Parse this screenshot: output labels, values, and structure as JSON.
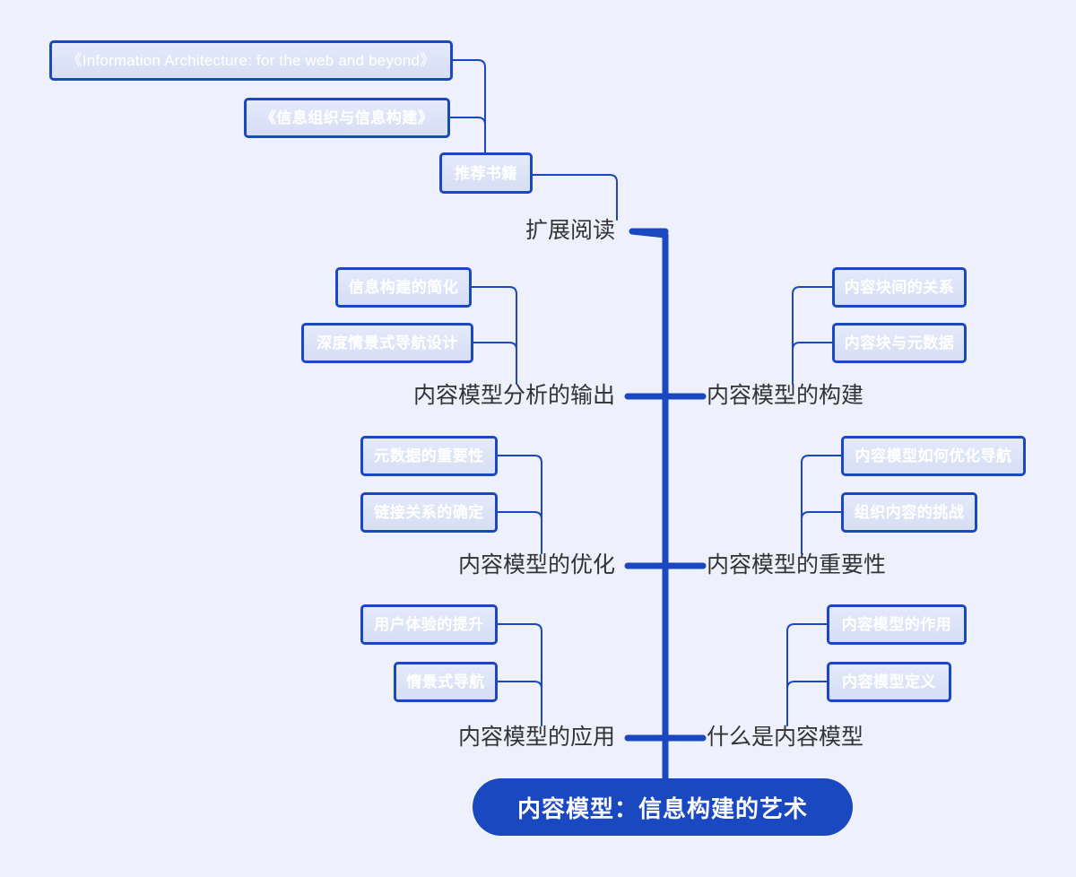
{
  "canvas": {
    "background_color": "#eef0fe",
    "trunk_color": "#1a48c0",
    "leaf_border_color": "#1a48c0",
    "leaf_fill_color": "#dce3f7",
    "leaf_text_color": "#ffffff",
    "branch_label_color": "#333333"
  },
  "root": {
    "label": "内容模型：信息构建的艺术"
  },
  "branches": [
    {
      "id": "extended-reading",
      "label": "扩展阅读",
      "side": "left",
      "children": [
        {
          "id": "recommended-books",
          "label": "推荐书籍",
          "children": [
            {
              "id": "book-ia-web-beyond",
              "label": "《Information Architecture: for the web and beyond》"
            },
            {
              "id": "book-info-org-ia",
              "label": "《信息组织与信息构建》"
            }
          ]
        }
      ]
    },
    {
      "id": "content-model-analysis-output",
      "label": "内容模型分析的输出",
      "side": "left",
      "leaves": [
        {
          "id": "simplify-ia",
          "label": "信息构建的简化"
        },
        {
          "id": "deep-contextual-nav-design",
          "label": "深度情景式导航设计"
        }
      ]
    },
    {
      "id": "content-model-construction",
      "label": "内容模型的构建",
      "side": "right",
      "leaves": [
        {
          "id": "relations-between-content-blocks",
          "label": "内容块间的关系"
        },
        {
          "id": "content-blocks-and-metadata",
          "label": "内容块与元数据"
        }
      ]
    },
    {
      "id": "content-model-optimization",
      "label": "内容模型的优化",
      "side": "left",
      "leaves": [
        {
          "id": "importance-of-metadata",
          "label": "元数据的重要性"
        },
        {
          "id": "determining-link-relations",
          "label": "链接关系的确定"
        }
      ]
    },
    {
      "id": "content-model-importance",
      "label": "内容模型的重要性",
      "side": "right",
      "leaves": [
        {
          "id": "how-content-model-optimizes-nav",
          "label": "内容模型如何优化导航"
        },
        {
          "id": "challenge-of-organizing-content",
          "label": "组织内容的挑战"
        }
      ]
    },
    {
      "id": "content-model-application",
      "label": "内容模型的应用",
      "side": "left",
      "leaves": [
        {
          "id": "improving-user-experience",
          "label": "用户体验的提升"
        },
        {
          "id": "contextual-navigation",
          "label": "情景式导航"
        }
      ]
    },
    {
      "id": "what-is-content-model",
      "label": "什么是内容模型",
      "side": "right",
      "leaves": [
        {
          "id": "role-of-content-model",
          "label": "内容模型的作用"
        },
        {
          "id": "content-model-definition",
          "label": "内容模型定义"
        }
      ]
    }
  ]
}
